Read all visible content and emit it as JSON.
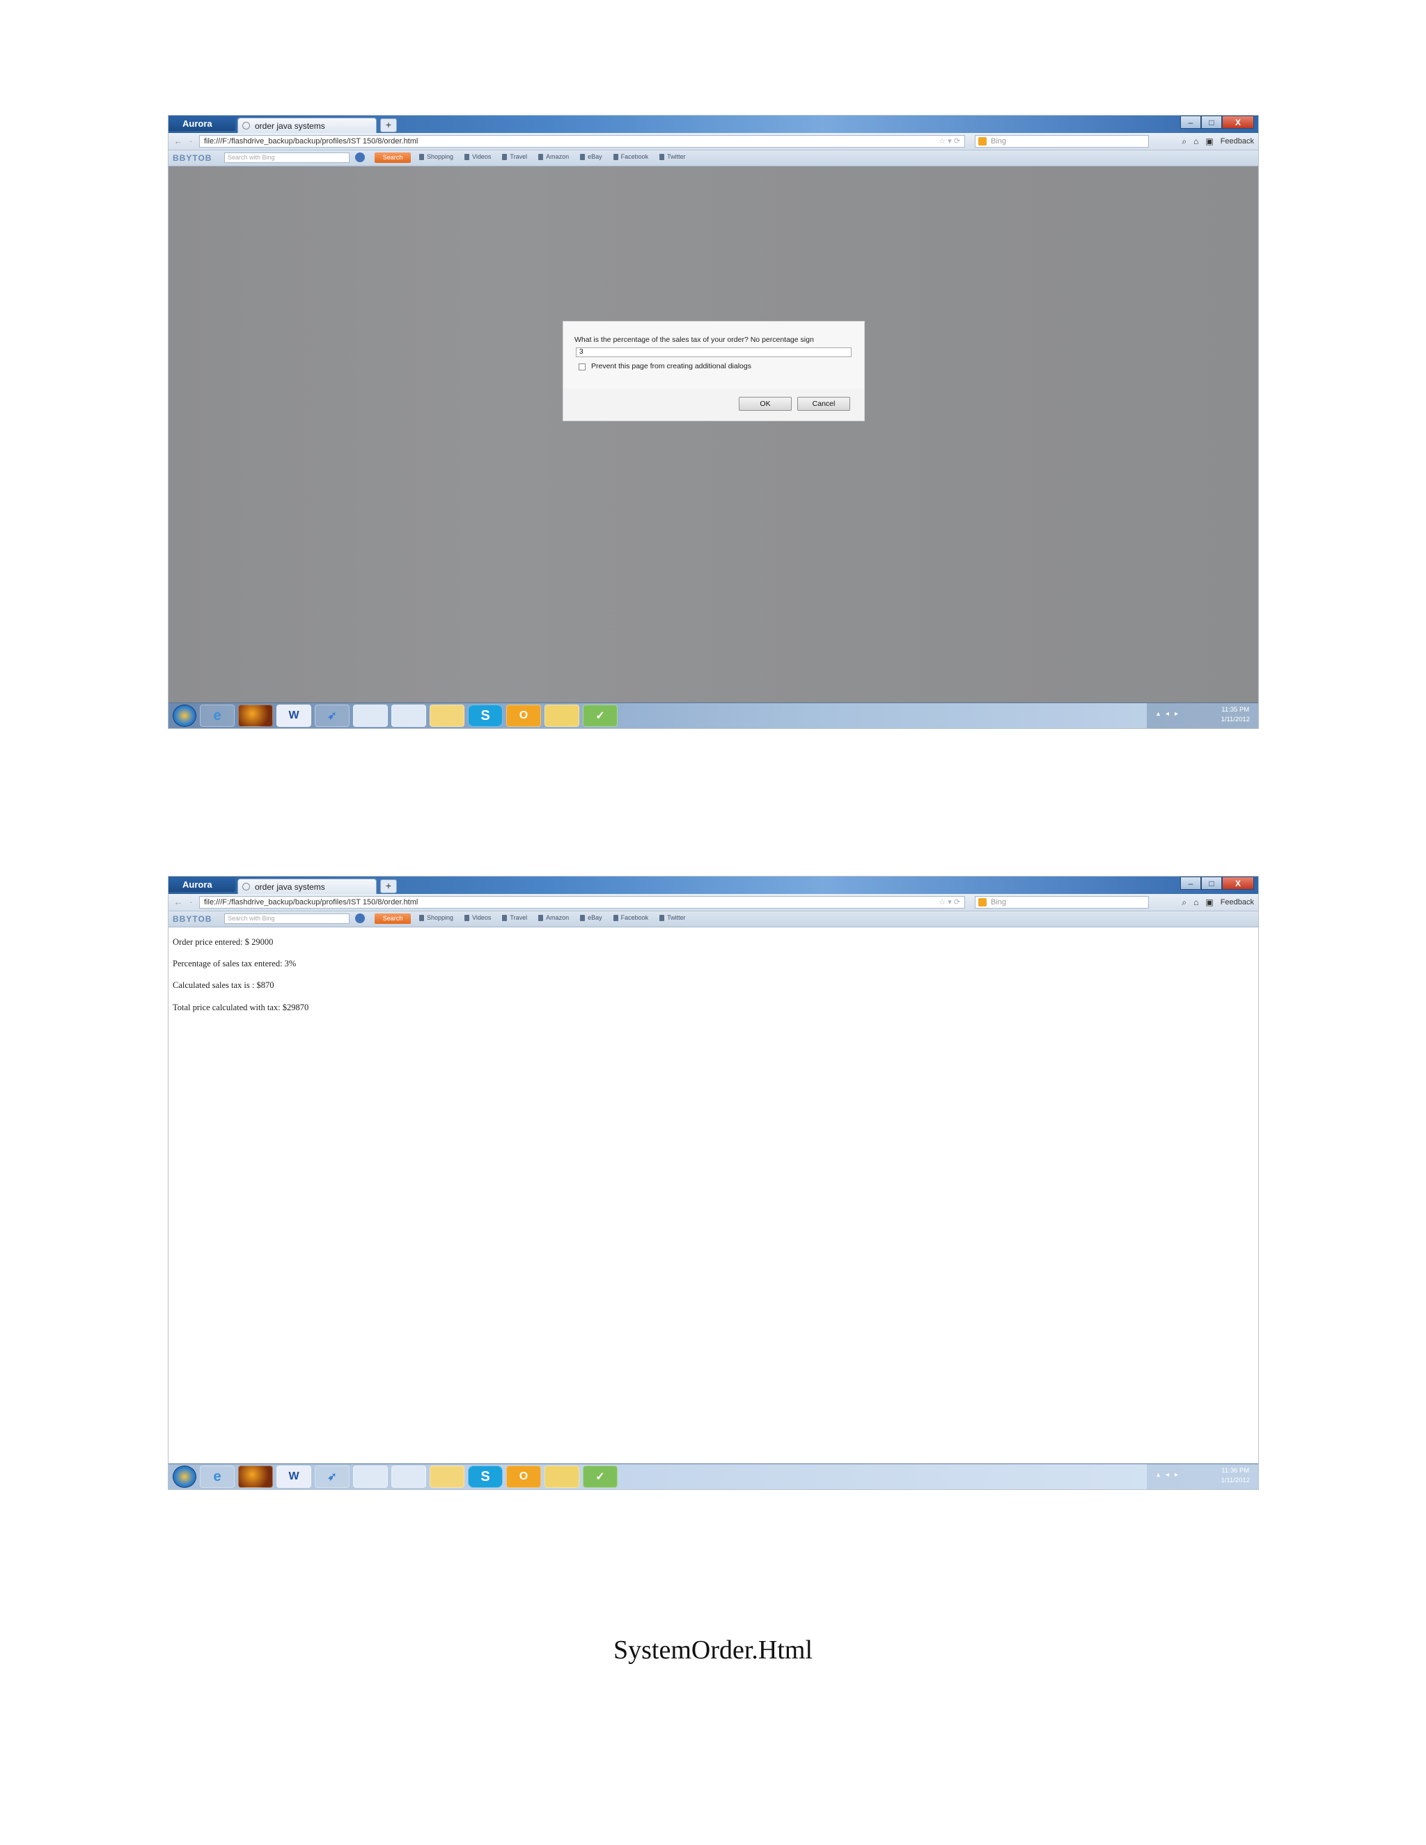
{
  "screens": [
    {
      "browser": {
        "app_menu": "Aurora",
        "tab_title": "order java systems",
        "new_tab": "+",
        "window_buttons": [
          "–",
          "□",
          "X"
        ],
        "url": "file:///F:/flashdrive_backup/backup/profiles/IST 150/8/order.html",
        "search_engine": "Bing",
        "nav_icons": [
          "search-icon",
          "home-icon",
          "bookmark-icon"
        ],
        "feedback": "Feedback"
      },
      "toolbar": {
        "brand": "BBYTOB",
        "search_placeholder": "Search with Bing",
        "search_button": "Search",
        "items": [
          "Shopping",
          "Videos",
          "Travel",
          "Amazon",
          "eBay",
          "Facebook",
          "Twitter"
        ]
      },
      "dialog": {
        "prompt": "What is the percentage of the sales tax of your order? No percentage sign",
        "input_value": "3",
        "checkbox_label": "Prevent this page from creating additional dialogs",
        "ok": "OK",
        "cancel": "Cancel"
      },
      "taskbar": {
        "time": "11:35 PM",
        "date": "1/11/2012"
      }
    },
    {
      "browser": {
        "app_menu": "Aurora",
        "tab_title": "order java systems",
        "new_tab": "+",
        "window_buttons": [
          "–",
          "□",
          "X"
        ],
        "url": "file:///F:/flashdrive_backup/backup/profiles/IST 150/8/order.html",
        "search_engine": "Bing",
        "feedback": "Feedback"
      },
      "toolbar": {
        "brand": "BBYTOB",
        "search_placeholder": "Search with Bing",
        "search_button": "Search",
        "items": [
          "Shopping",
          "Videos",
          "Travel",
          "Amazon",
          "eBay",
          "Facebook",
          "Twitter"
        ]
      },
      "output_lines": [
        "Order price entered: $ 29000",
        "Percentage of sales tax entered: 3%",
        "Calculated sales tax is : $870",
        "Total price calculated with tax: $29870"
      ],
      "taskbar": {
        "time": "11:36 PM",
        "date": "1/11/2012"
      }
    }
  ],
  "caption": "SystemOrder.Html"
}
